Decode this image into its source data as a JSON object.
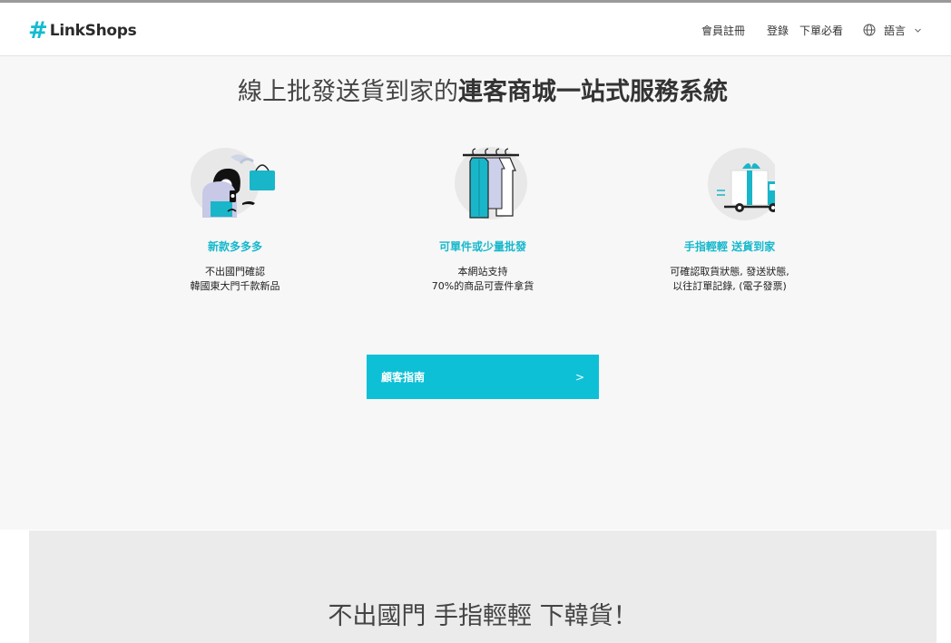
{
  "header": {
    "logo_hash": "#",
    "logo_text": "LinkShops",
    "nav_register": "會員註冊",
    "nav_login": "登錄",
    "nav_guide": "下單必看",
    "nav_language": "語言"
  },
  "hero": {
    "title_normal": "線上批發送貨到家的",
    "title_strong": "連客商城一站式服務系統",
    "features": [
      {
        "title": "新款多多多",
        "desc": "不出國門確認\n韓國東大門千款新品",
        "icon": "shopper-illustration"
      },
      {
        "title": "可單件或少量批發",
        "desc": "本網站支持\n70%的商品可壹件拿貨",
        "icon": "clothes-rack-illustration"
      },
      {
        "title": "手指輕輕 送貨到家",
        "desc": "可確認取貨狀態, 發送狀態,\n以往訂單記錄, (電子發票)",
        "icon": "delivery-truck-illustration"
      }
    ],
    "cta_label": "顧客指南",
    "cta_arrow": ">"
  },
  "section2": {
    "title": "不出國門 手指輕輕 下韓貨！"
  },
  "colors": {
    "brand": "#12bcd1",
    "cta": "#0ec0d6",
    "hero_bg": "#f7f7f7",
    "section_bg": "#ebebeb"
  }
}
